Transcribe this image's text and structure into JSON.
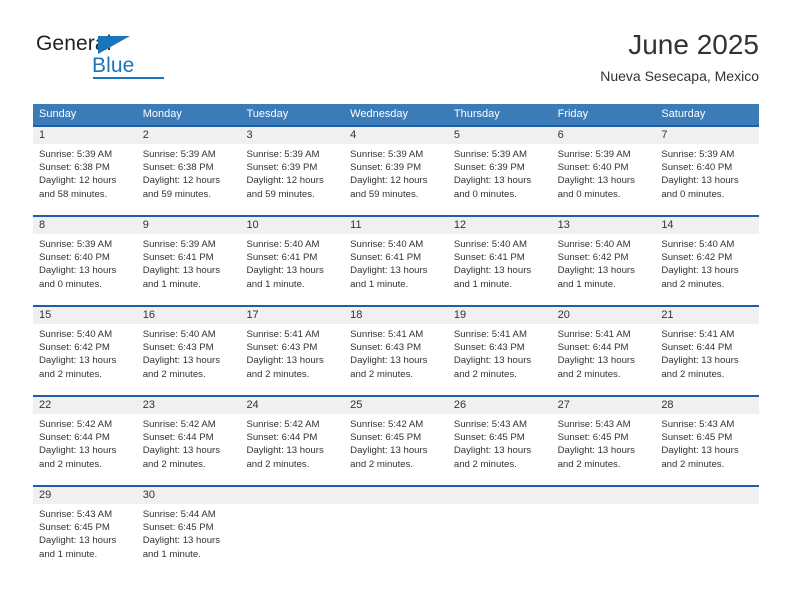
{
  "brand": {
    "name_part1": "General",
    "name_part2": "Blue",
    "triangle_icon": "triangle-icon",
    "color_primary": "#1b75bb",
    "color_text": "#231f20"
  },
  "header": {
    "title": "June 2025",
    "subtitle": "Nueva Sesecapa, Mexico"
  },
  "calendar": {
    "header_bg": "#3b7cb8",
    "row_border": "#1f5fa9",
    "day_band_bg": "#f0f0f0",
    "weekdays": [
      "Sunday",
      "Monday",
      "Tuesday",
      "Wednesday",
      "Thursday",
      "Friday",
      "Saturday"
    ],
    "weeks": [
      [
        {
          "day": "1",
          "sunrise": "Sunrise: 5:39 AM",
          "sunset": "Sunset: 6:38 PM",
          "daylight1": "Daylight: 12 hours",
          "daylight2": "and 58 minutes."
        },
        {
          "day": "2",
          "sunrise": "Sunrise: 5:39 AM",
          "sunset": "Sunset: 6:38 PM",
          "daylight1": "Daylight: 12 hours",
          "daylight2": "and 59 minutes."
        },
        {
          "day": "3",
          "sunrise": "Sunrise: 5:39 AM",
          "sunset": "Sunset: 6:39 PM",
          "daylight1": "Daylight: 12 hours",
          "daylight2": "and 59 minutes."
        },
        {
          "day": "4",
          "sunrise": "Sunrise: 5:39 AM",
          "sunset": "Sunset: 6:39 PM",
          "daylight1": "Daylight: 12 hours",
          "daylight2": "and 59 minutes."
        },
        {
          "day": "5",
          "sunrise": "Sunrise: 5:39 AM",
          "sunset": "Sunset: 6:39 PM",
          "daylight1": "Daylight: 13 hours",
          "daylight2": "and 0 minutes."
        },
        {
          "day": "6",
          "sunrise": "Sunrise: 5:39 AM",
          "sunset": "Sunset: 6:40 PM",
          "daylight1": "Daylight: 13 hours",
          "daylight2": "and 0 minutes."
        },
        {
          "day": "7",
          "sunrise": "Sunrise: 5:39 AM",
          "sunset": "Sunset: 6:40 PM",
          "daylight1": "Daylight: 13 hours",
          "daylight2": "and 0 minutes."
        }
      ],
      [
        {
          "day": "8",
          "sunrise": "Sunrise: 5:39 AM",
          "sunset": "Sunset: 6:40 PM",
          "daylight1": "Daylight: 13 hours",
          "daylight2": "and 0 minutes."
        },
        {
          "day": "9",
          "sunrise": "Sunrise: 5:39 AM",
          "sunset": "Sunset: 6:41 PM",
          "daylight1": "Daylight: 13 hours",
          "daylight2": "and 1 minute."
        },
        {
          "day": "10",
          "sunrise": "Sunrise: 5:40 AM",
          "sunset": "Sunset: 6:41 PM",
          "daylight1": "Daylight: 13 hours",
          "daylight2": "and 1 minute."
        },
        {
          "day": "11",
          "sunrise": "Sunrise: 5:40 AM",
          "sunset": "Sunset: 6:41 PM",
          "daylight1": "Daylight: 13 hours",
          "daylight2": "and 1 minute."
        },
        {
          "day": "12",
          "sunrise": "Sunrise: 5:40 AM",
          "sunset": "Sunset: 6:41 PM",
          "daylight1": "Daylight: 13 hours",
          "daylight2": "and 1 minute."
        },
        {
          "day": "13",
          "sunrise": "Sunrise: 5:40 AM",
          "sunset": "Sunset: 6:42 PM",
          "daylight1": "Daylight: 13 hours",
          "daylight2": "and 1 minute."
        },
        {
          "day": "14",
          "sunrise": "Sunrise: 5:40 AM",
          "sunset": "Sunset: 6:42 PM",
          "daylight1": "Daylight: 13 hours",
          "daylight2": "and 2 minutes."
        }
      ],
      [
        {
          "day": "15",
          "sunrise": "Sunrise: 5:40 AM",
          "sunset": "Sunset: 6:42 PM",
          "daylight1": "Daylight: 13 hours",
          "daylight2": "and 2 minutes."
        },
        {
          "day": "16",
          "sunrise": "Sunrise: 5:40 AM",
          "sunset": "Sunset: 6:43 PM",
          "daylight1": "Daylight: 13 hours",
          "daylight2": "and 2 minutes."
        },
        {
          "day": "17",
          "sunrise": "Sunrise: 5:41 AM",
          "sunset": "Sunset: 6:43 PM",
          "daylight1": "Daylight: 13 hours",
          "daylight2": "and 2 minutes."
        },
        {
          "day": "18",
          "sunrise": "Sunrise: 5:41 AM",
          "sunset": "Sunset: 6:43 PM",
          "daylight1": "Daylight: 13 hours",
          "daylight2": "and 2 minutes."
        },
        {
          "day": "19",
          "sunrise": "Sunrise: 5:41 AM",
          "sunset": "Sunset: 6:43 PM",
          "daylight1": "Daylight: 13 hours",
          "daylight2": "and 2 minutes."
        },
        {
          "day": "20",
          "sunrise": "Sunrise: 5:41 AM",
          "sunset": "Sunset: 6:44 PM",
          "daylight1": "Daylight: 13 hours",
          "daylight2": "and 2 minutes."
        },
        {
          "day": "21",
          "sunrise": "Sunrise: 5:41 AM",
          "sunset": "Sunset: 6:44 PM",
          "daylight1": "Daylight: 13 hours",
          "daylight2": "and 2 minutes."
        }
      ],
      [
        {
          "day": "22",
          "sunrise": "Sunrise: 5:42 AM",
          "sunset": "Sunset: 6:44 PM",
          "daylight1": "Daylight: 13 hours",
          "daylight2": "and 2 minutes."
        },
        {
          "day": "23",
          "sunrise": "Sunrise: 5:42 AM",
          "sunset": "Sunset: 6:44 PM",
          "daylight1": "Daylight: 13 hours",
          "daylight2": "and 2 minutes."
        },
        {
          "day": "24",
          "sunrise": "Sunrise: 5:42 AM",
          "sunset": "Sunset: 6:44 PM",
          "daylight1": "Daylight: 13 hours",
          "daylight2": "and 2 minutes."
        },
        {
          "day": "25",
          "sunrise": "Sunrise: 5:42 AM",
          "sunset": "Sunset: 6:45 PM",
          "daylight1": "Daylight: 13 hours",
          "daylight2": "and 2 minutes."
        },
        {
          "day": "26",
          "sunrise": "Sunrise: 5:43 AM",
          "sunset": "Sunset: 6:45 PM",
          "daylight1": "Daylight: 13 hours",
          "daylight2": "and 2 minutes."
        },
        {
          "day": "27",
          "sunrise": "Sunrise: 5:43 AM",
          "sunset": "Sunset: 6:45 PM",
          "daylight1": "Daylight: 13 hours",
          "daylight2": "and 2 minutes."
        },
        {
          "day": "28",
          "sunrise": "Sunrise: 5:43 AM",
          "sunset": "Sunset: 6:45 PM",
          "daylight1": "Daylight: 13 hours",
          "daylight2": "and 2 minutes."
        }
      ],
      [
        {
          "day": "29",
          "sunrise": "Sunrise: 5:43 AM",
          "sunset": "Sunset: 6:45 PM",
          "daylight1": "Daylight: 13 hours",
          "daylight2": "and 1 minute."
        },
        {
          "day": "30",
          "sunrise": "Sunrise: 5:44 AM",
          "sunset": "Sunset: 6:45 PM",
          "daylight1": "Daylight: 13 hours",
          "daylight2": "and 1 minute."
        },
        {
          "day": "",
          "sunrise": "",
          "sunset": "",
          "daylight1": "",
          "daylight2": ""
        },
        {
          "day": "",
          "sunrise": "",
          "sunset": "",
          "daylight1": "",
          "daylight2": ""
        },
        {
          "day": "",
          "sunrise": "",
          "sunset": "",
          "daylight1": "",
          "daylight2": ""
        },
        {
          "day": "",
          "sunrise": "",
          "sunset": "",
          "daylight1": "",
          "daylight2": ""
        },
        {
          "day": "",
          "sunrise": "",
          "sunset": "",
          "daylight1": "",
          "daylight2": ""
        }
      ]
    ]
  }
}
